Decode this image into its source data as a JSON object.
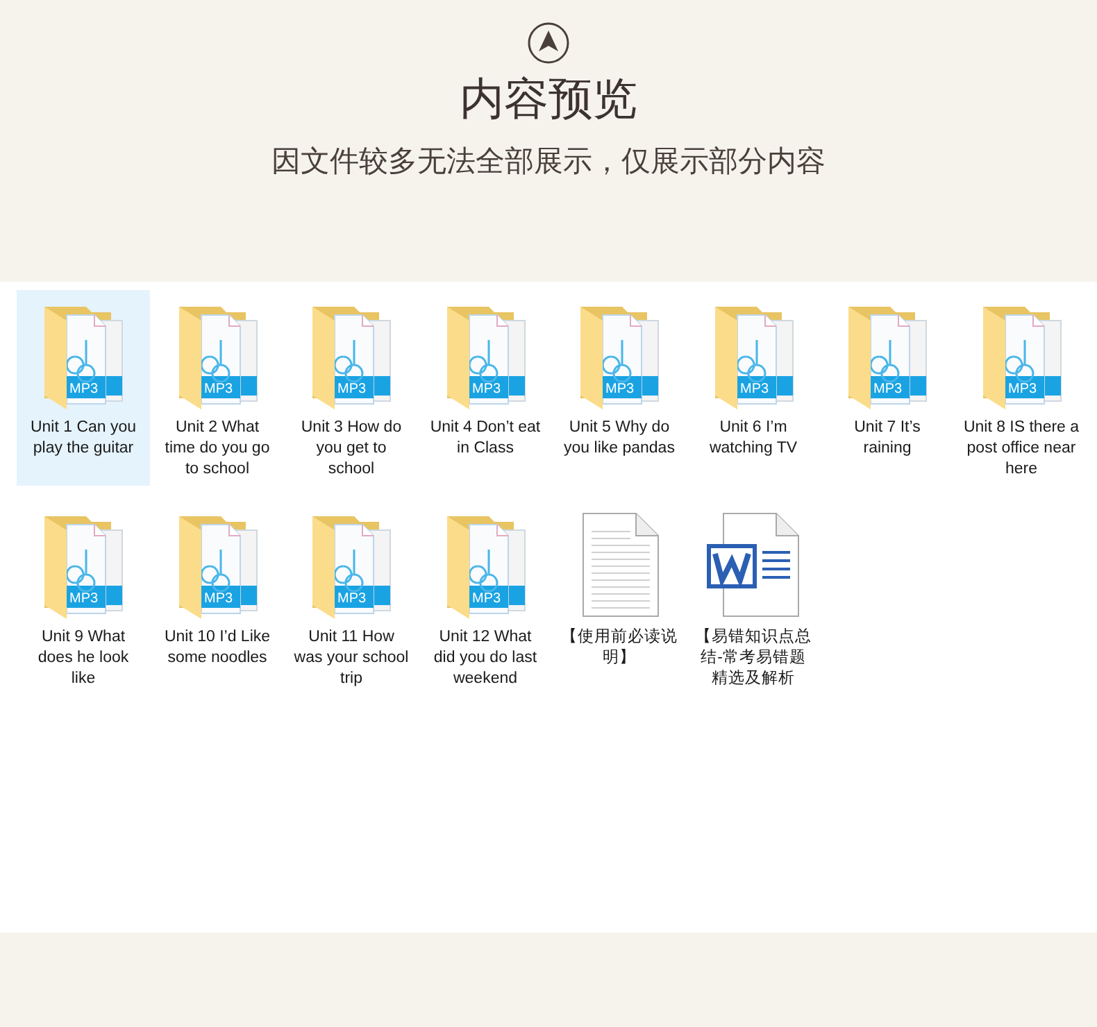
{
  "header": {
    "title": "内容预览",
    "subtitle": "因文件较多无法全部展示，仅展示部分内容"
  },
  "files": [
    {
      "kind": "folder",
      "badge": "MP3",
      "name": "Unit 1 Can you play the guitar",
      "selected": true
    },
    {
      "kind": "folder",
      "badge": "MP3",
      "name": "Unit 2 What time do you go to school",
      "selected": false
    },
    {
      "kind": "folder",
      "badge": "MP3",
      "name": "Unit 3 How do you get to school",
      "selected": false
    },
    {
      "kind": "folder",
      "badge": "MP3",
      "name": "Unit 4 Don’t eat in Class",
      "selected": false
    },
    {
      "kind": "folder",
      "badge": "MP3",
      "name": "Unit 5 Why do you like pandas",
      "selected": false
    },
    {
      "kind": "folder",
      "badge": "MP3",
      "name": "Unit 6 I’m watching TV",
      "selected": false
    },
    {
      "kind": "folder",
      "badge": "MP3",
      "name": "Unit 7 It’s raining",
      "selected": false
    },
    {
      "kind": "folder",
      "badge": "MP3",
      "name": "Unit 8 IS there a post office near here",
      "selected": false
    },
    {
      "kind": "folder",
      "badge": "MP3",
      "name": "Unit 9 What does he look like",
      "selected": false
    },
    {
      "kind": "folder",
      "badge": "MP3",
      "name": "Unit 10 I’d Like some noodles",
      "selected": false
    },
    {
      "kind": "folder",
      "badge": "MP3",
      "name": "Unit 11 How was your school trip",
      "selected": false
    },
    {
      "kind": "folder",
      "badge": "MP3",
      "name": "Unit 12 What did you do last weekend",
      "selected": false
    },
    {
      "kind": "text",
      "name": "【使用前必读说明】",
      "selected": false
    },
    {
      "kind": "word",
      "name": "【易错知识点总结-常考易错题精选及解析",
      "selected": false
    }
  ]
}
